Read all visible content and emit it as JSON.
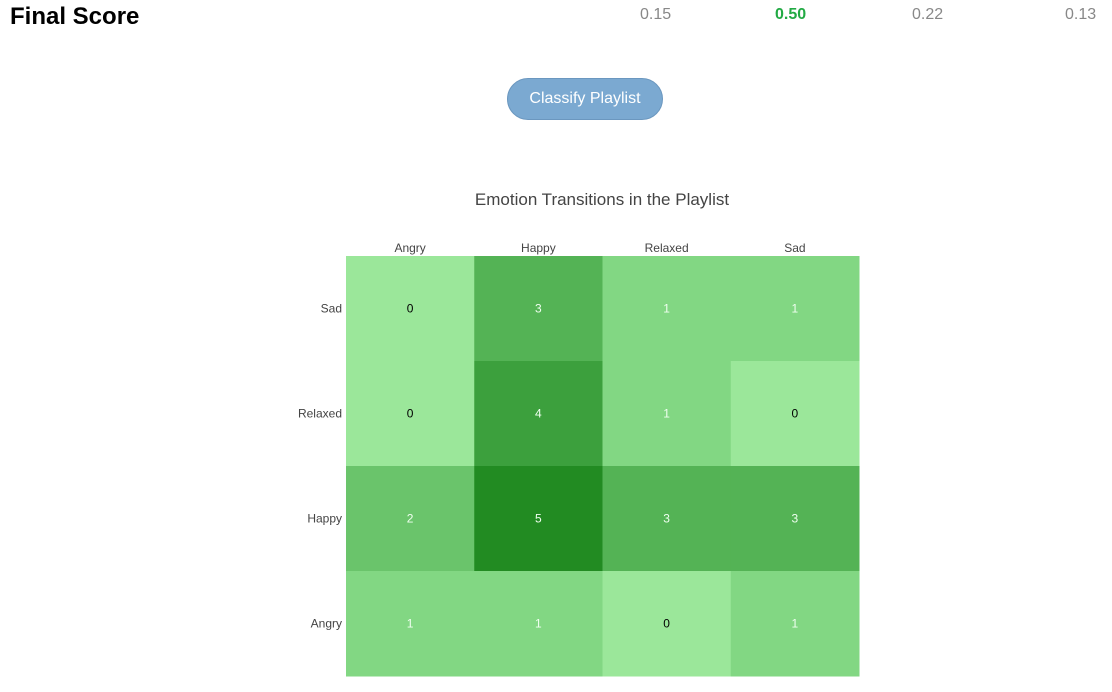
{
  "header": {
    "title": "Final Score",
    "scores": [
      {
        "value": "0.15",
        "highlight": false
      },
      {
        "value": "0.50",
        "highlight": true
      },
      {
        "value": "0.22",
        "highlight": false
      },
      {
        "value": "0.13",
        "highlight": false
      }
    ]
  },
  "actions": {
    "classify_label": "Classify Playlist"
  },
  "chart_data": {
    "type": "heatmap",
    "title": "Emotion Transitions in the Playlist",
    "x_categories": [
      "Angry",
      "Happy",
      "Relaxed",
      "Sad"
    ],
    "y_categories": [
      "Sad",
      "Relaxed",
      "Happy",
      "Angry"
    ],
    "values": [
      [
        0,
        3,
        1,
        1
      ],
      [
        0,
        4,
        1,
        0
      ],
      [
        2,
        5,
        3,
        3
      ],
      [
        1,
        1,
        0,
        1
      ]
    ],
    "color_scale": [
      "#9be79a",
      "#82d783",
      "#6ac46b",
      "#54b355",
      "#3ca03d",
      "#228b22"
    ],
    "legend": "none"
  }
}
